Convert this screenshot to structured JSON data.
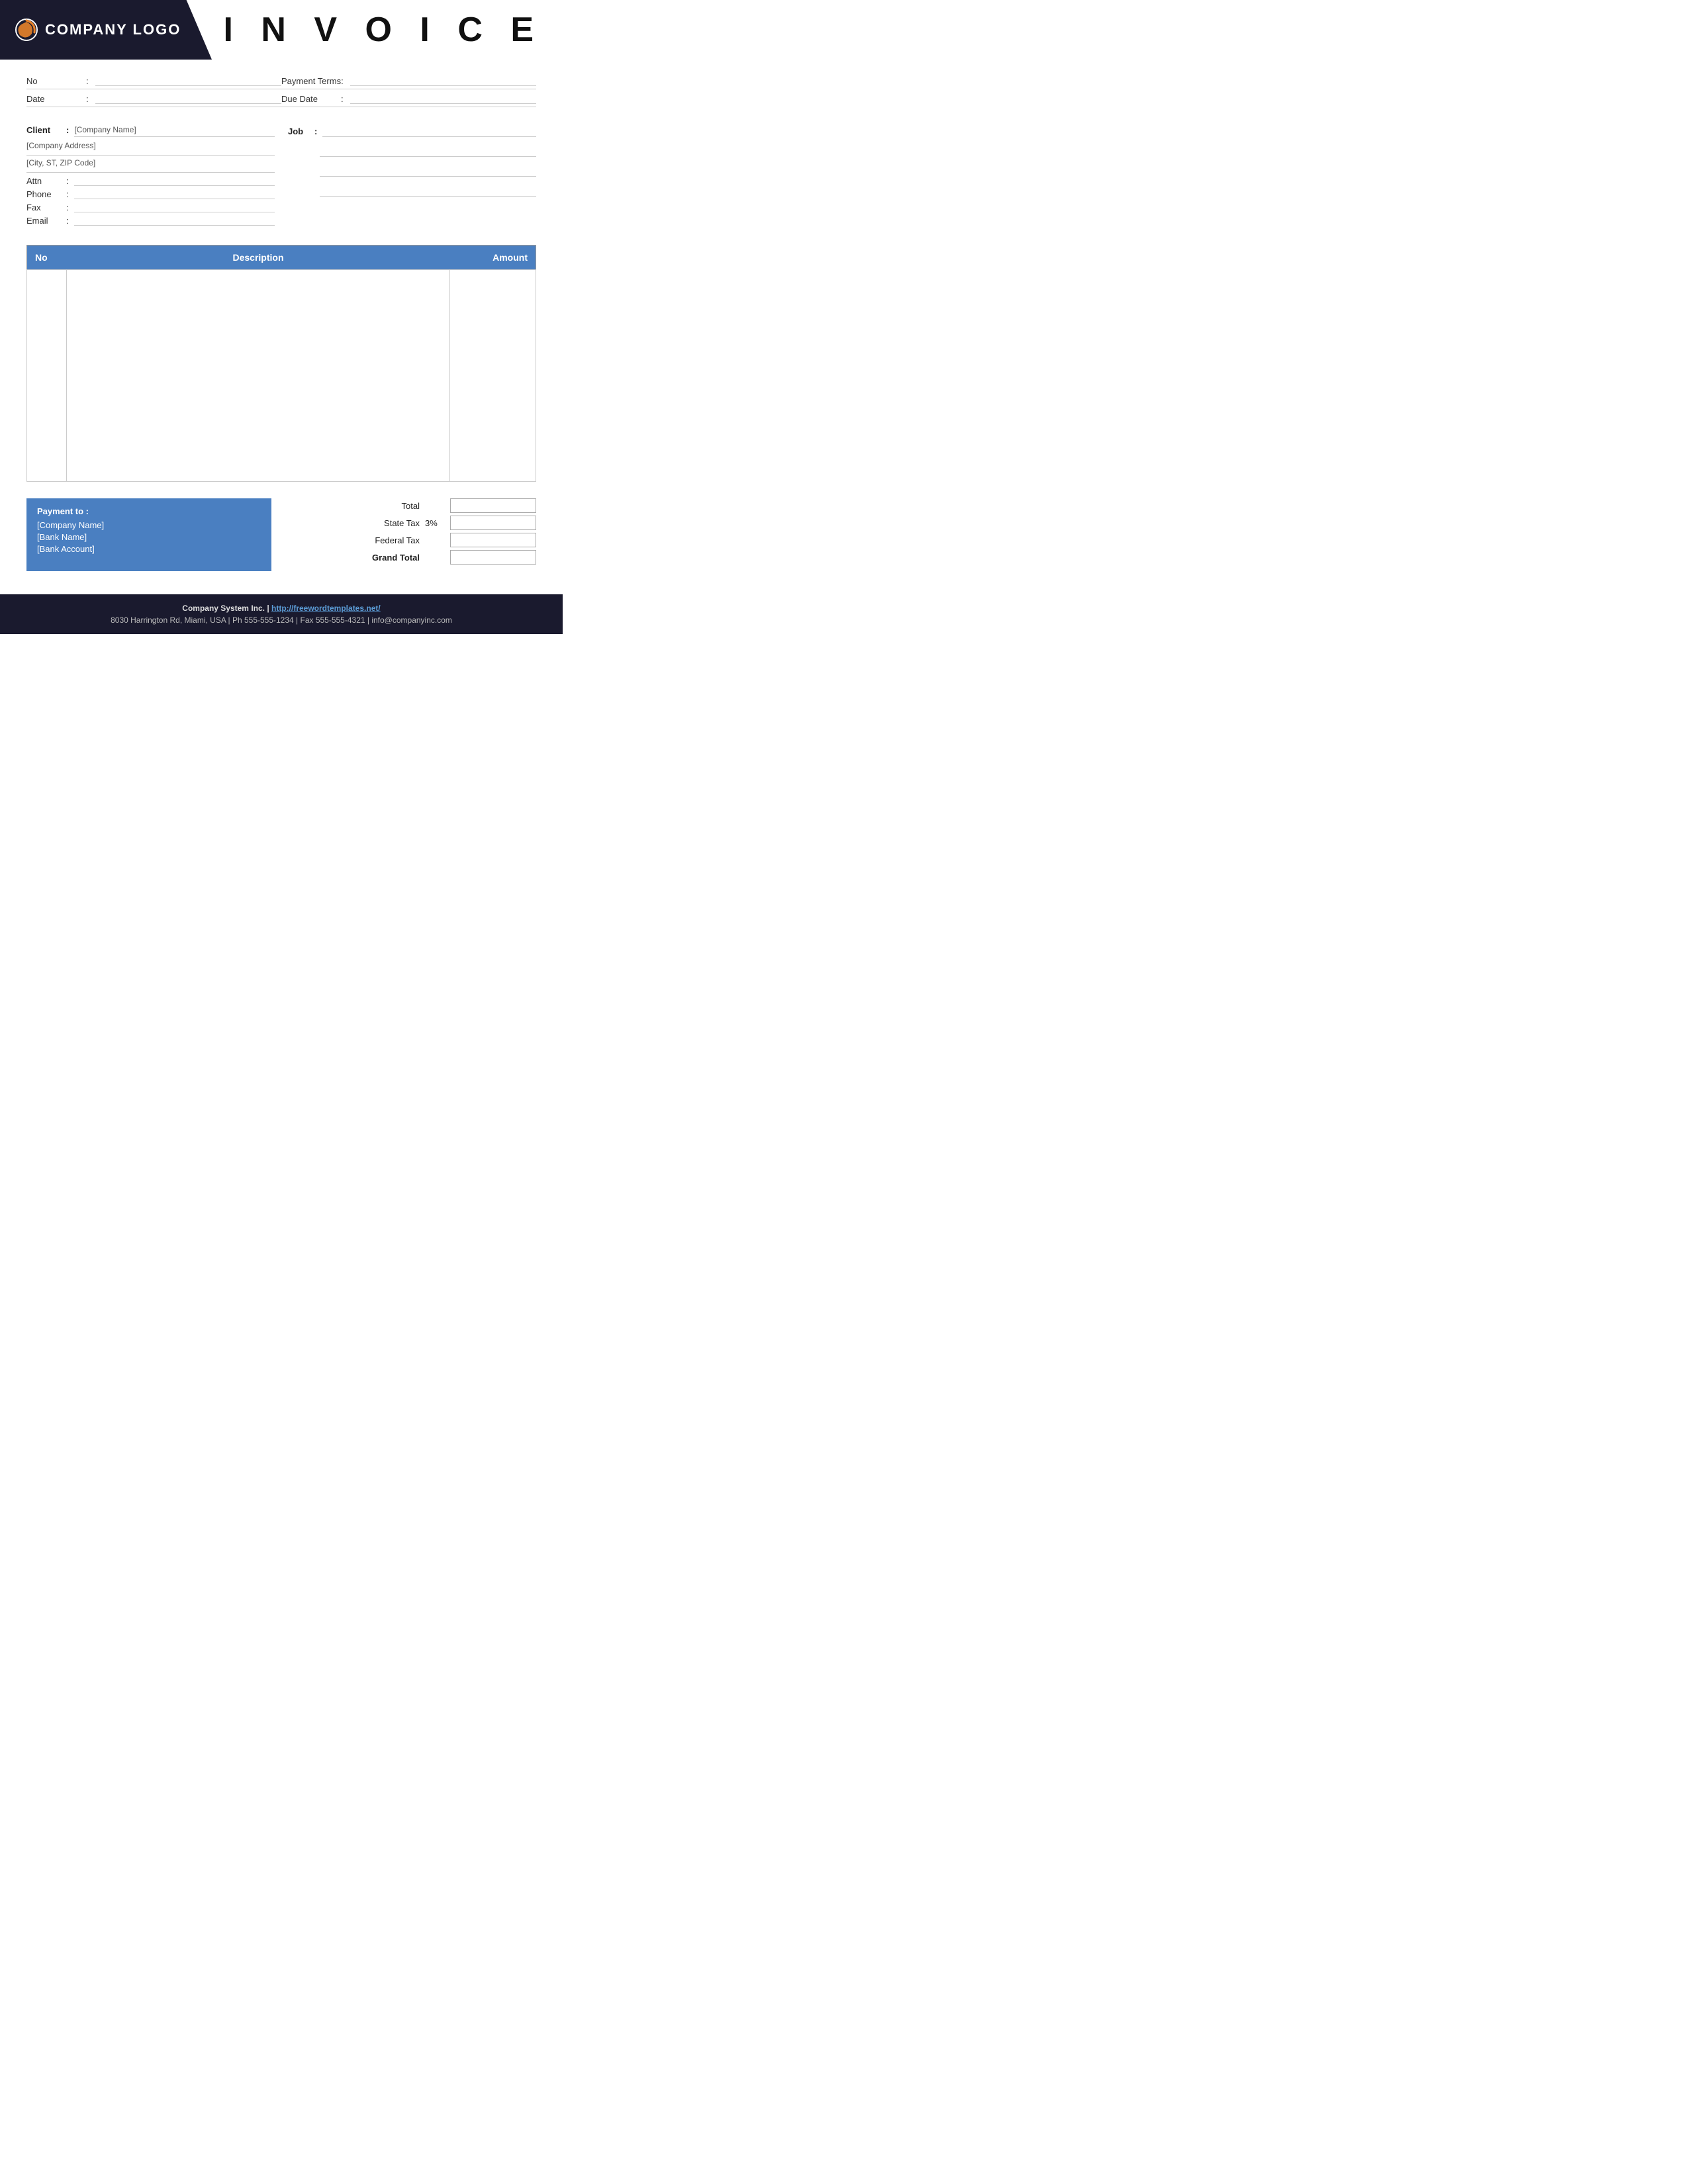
{
  "header": {
    "logo_text": "COMPANY LOGO",
    "invoice_title": "I N V O I C E"
  },
  "info": {
    "no_label": "No",
    "no_colon": ":",
    "date_label": "Date",
    "date_colon": ":",
    "payment_terms_label": "Payment  Terms",
    "payment_terms_colon": ":",
    "due_date_label": "Due Date",
    "due_date_colon": ":"
  },
  "client": {
    "label": "Client",
    "colon": ":",
    "company_name": "[Company Name]",
    "company_address": "[Company Address]",
    "city_zip": "[City, ST, ZIP Code]",
    "attn_label": "Attn",
    "attn_colon": ":",
    "phone_label": "Phone",
    "phone_colon": ":",
    "fax_label": "Fax",
    "fax_colon": ":",
    "email_label": "Email",
    "email_colon": ":"
  },
  "job": {
    "label": "Job",
    "colon": ":"
  },
  "table": {
    "col_no": "No",
    "col_description": "Description",
    "col_amount": "Amount"
  },
  "payment": {
    "title": "Payment to :",
    "company_name": "[Company Name]",
    "bank_name": "[Bank Name]",
    "bank_account": "[Bank Account]"
  },
  "totals": {
    "total_label": "Total",
    "state_tax_label": "State Tax",
    "state_tax_percent": "3%",
    "federal_tax_label": "Federal Tax",
    "grand_total_label": "Grand Total"
  },
  "footer": {
    "line1_text": "Company System Inc. | ",
    "line1_link": "http://freewordtemplates.net/",
    "line2": "8030 Harrington Rd, Miami, USA | Ph 555-555-1234 | Fax 555-555-4321 | info@companyinc.com"
  }
}
